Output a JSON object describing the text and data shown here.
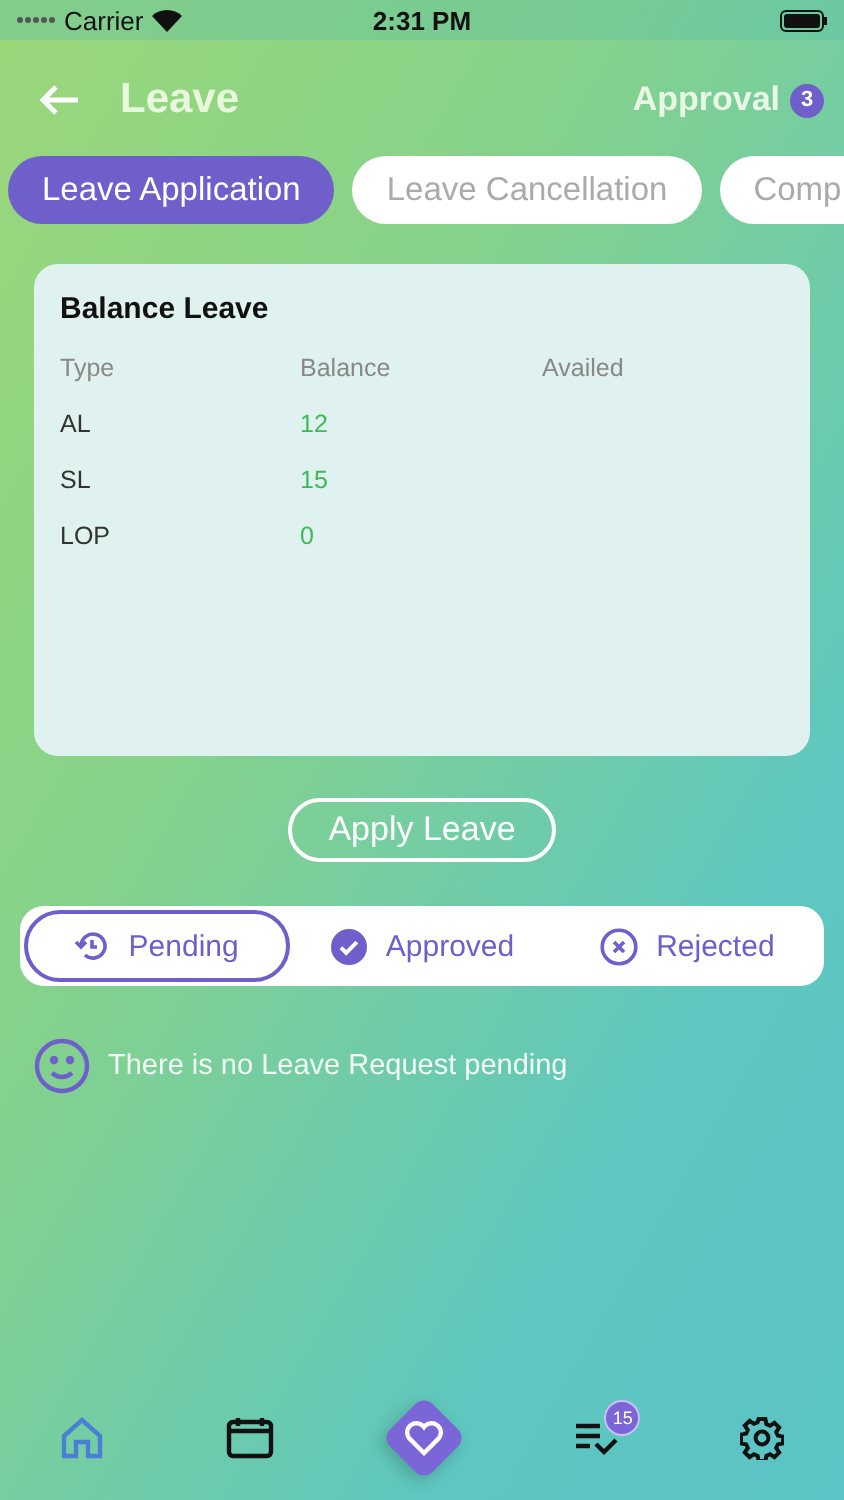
{
  "status_bar": {
    "carrier": "Carrier",
    "time": "2:31 PM"
  },
  "header": {
    "title": "Leave",
    "approval_label": "Approval",
    "approval_count": "3"
  },
  "tabs": [
    {
      "label": "Leave Application",
      "selected": true
    },
    {
      "label": "Leave Cancellation",
      "selected": false
    },
    {
      "label": "Comp",
      "selected": false
    }
  ],
  "balance_card": {
    "title": "Balance Leave",
    "columns": [
      "Type",
      "Balance",
      "Availed"
    ],
    "rows": [
      {
        "type": "AL",
        "balance": "12"
      },
      {
        "type": "SL",
        "balance": "15"
      },
      {
        "type": "LOP",
        "balance": "0"
      }
    ]
  },
  "apply_button": "Apply Leave",
  "filters": [
    {
      "kind": "pending",
      "label": "Pending",
      "selected": true
    },
    {
      "kind": "approved",
      "label": "Approved",
      "selected": false
    },
    {
      "kind": "rejected",
      "label": "Rejected",
      "selected": false
    }
  ],
  "empty_message": "There is no Leave Request pending",
  "bottom_nav": [
    {
      "kind": "home",
      "selected": true
    },
    {
      "kind": "calendar",
      "selected": false
    },
    {
      "kind": "heart",
      "selected": false
    },
    {
      "kind": "tasks",
      "selected": false,
      "badge": "15"
    },
    {
      "kind": "settings",
      "selected": false
    }
  ]
}
